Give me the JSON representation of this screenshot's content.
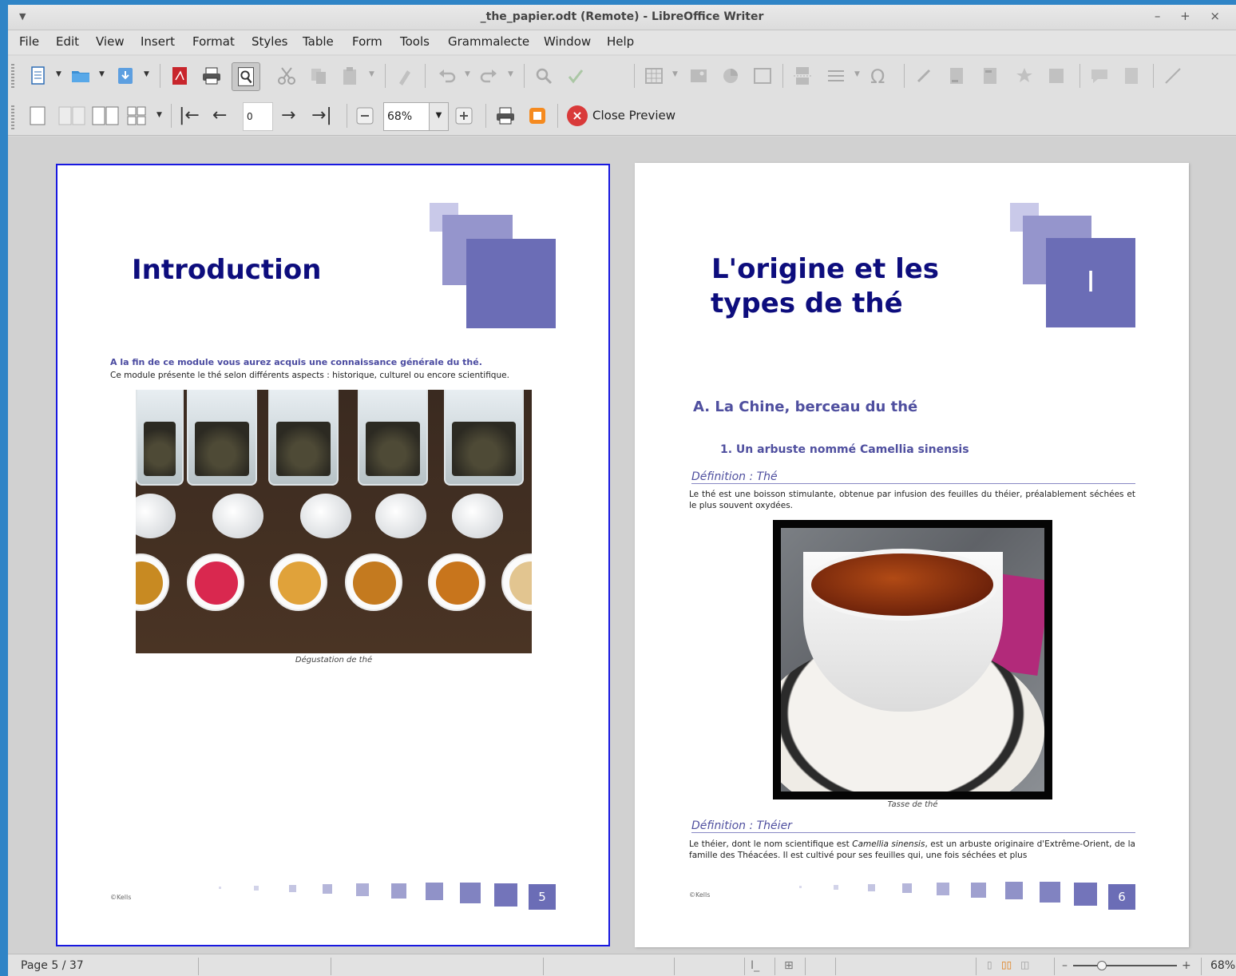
{
  "window": {
    "title": "_the_papier.odt (Remote) - LibreOffice Writer",
    "controls": "– + ×"
  },
  "menu": [
    "File",
    "Edit",
    "View",
    "Insert",
    "Format",
    "Styles",
    "Table",
    "Form",
    "Tools",
    "Grammalecte",
    "Window",
    "Help"
  ],
  "preview_toolbar": {
    "page_input": "0",
    "zoom": "68%",
    "close_preview": "Close Preview"
  },
  "page5": {
    "title": "Introduction",
    "lead_bold": "A la fin de ce module vous aurez acquis une connaissance générale du thé.",
    "lead_text": "Ce module présente le thé selon différents aspects : historique, culturel ou encore scientifique.",
    "caption": "Dégustation de thé",
    "copyright": "©Kells",
    "page_number": "5"
  },
  "page6": {
    "title_line1": "L'origine et les",
    "title_line2": "types de thé",
    "chapter_numeral": "I",
    "section": "A. La Chine, berceau du thé",
    "subsection": "1. Un arbuste nommé Camellia sinensis",
    "def1_title": "Définition : Thé",
    "def1_text": "Le thé est une boisson stimulante, obtenue par infusion des feuilles du théier, préalablement séchées et le plus souvent oxydées.",
    "caption": "Tasse de thé",
    "def2_title": "Définition : Théier",
    "def2_text_a": "Le théier, dont le nom scientifique est ",
    "def2_text_em": "Camellia sinensis",
    "def2_text_b": ", est un arbuste originaire d'Extrême-Orient, de la famille des Théacées. Il est cultivé pour ses feuilles qui, une fois séchées et plus",
    "copyright": "©Kells",
    "page_number": "6"
  },
  "statusbar": {
    "page": "Page 5 / 37",
    "zoom": "68%"
  },
  "colors": {
    "accent": "#6b6db6",
    "title": "#0d0d7d",
    "selection_border": "#1818e0"
  },
  "icons": [
    "new-document-icon",
    "open-folder-icon",
    "save-icon",
    "export-pdf-icon",
    "print-icon",
    "print-preview-icon",
    "cut-icon",
    "copy-icon",
    "paste-icon",
    "clone-format-icon",
    "undo-icon",
    "redo-icon",
    "find-replace-icon",
    "spellcheck-icon",
    "insert-table-icon",
    "insert-image-icon",
    "insert-chart-icon",
    "insert-textbox-icon",
    "page-break-icon",
    "insert-field-icon",
    "special-character-icon",
    "hyperlink-icon",
    "footnote-icon",
    "endnote-icon",
    "bookmark-icon",
    "cross-reference-icon",
    "comment-icon",
    "track-changes-icon",
    "line-icon",
    "single-page-icon",
    "two-pages-icon",
    "book-view-icon",
    "multi-page-icon",
    "first-page-icon",
    "previous-page-icon",
    "next-page-icon",
    "last-page-icon",
    "zoom-out-icon",
    "zoom-in-icon",
    "full-screen-icon",
    "close-icon"
  ]
}
